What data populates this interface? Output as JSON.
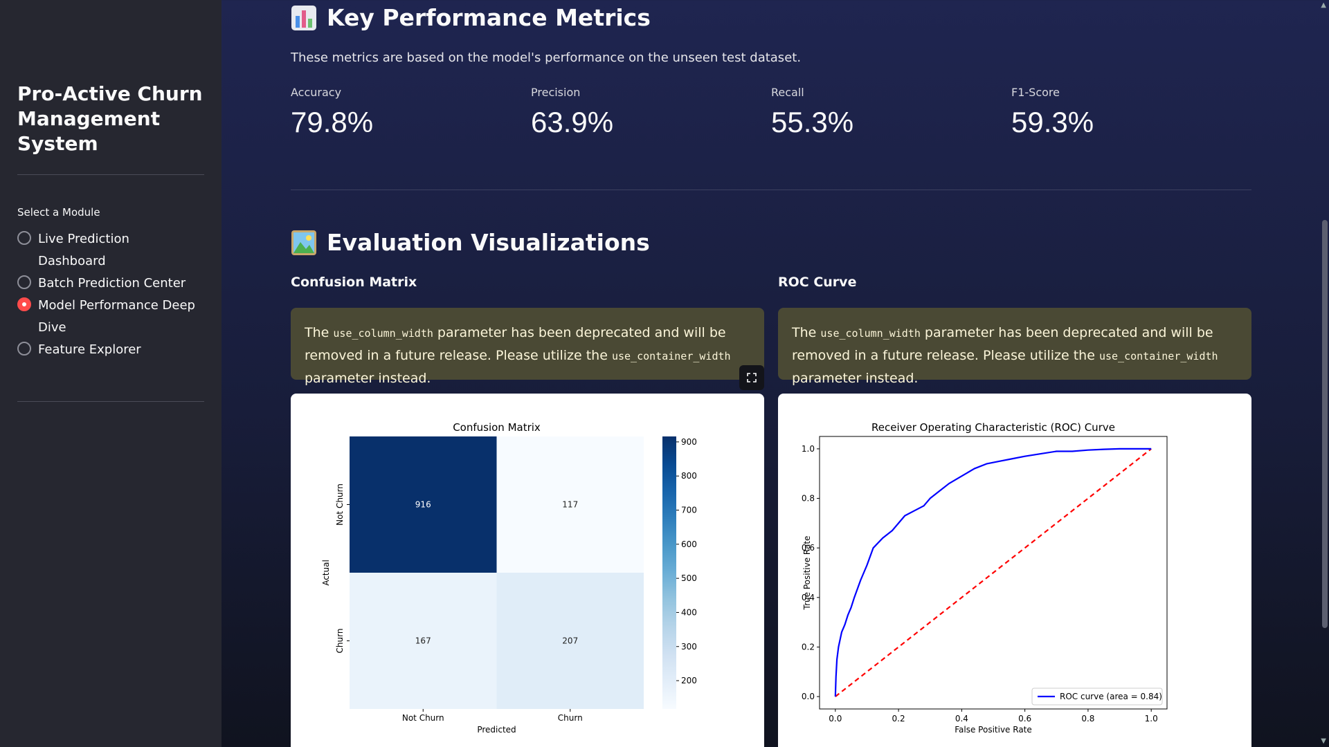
{
  "sidebar": {
    "app_title": "Pro-Active Churn Management System",
    "module_label": "Select a Module",
    "modules": [
      {
        "label": "Live Prediction Dashboard",
        "selected": false
      },
      {
        "label": "Batch Prediction Center",
        "selected": false
      },
      {
        "label": "Model Performance Deep Dive",
        "selected": true
      },
      {
        "label": "Feature Explorer",
        "selected": false
      }
    ]
  },
  "metrics_section": {
    "title": "Key Performance Metrics",
    "icon": "bar-chart-icon",
    "caption": "These metrics are based on the model's performance on the unseen test dataset.",
    "metrics": [
      {
        "label": "Accuracy",
        "value": "79.8%"
      },
      {
        "label": "Precision",
        "value": "63.9%"
      },
      {
        "label": "Recall",
        "value": "55.3%"
      },
      {
        "label": "F1-Score",
        "value": "59.3%"
      }
    ]
  },
  "viz_section": {
    "title": "Evaluation Visualizations",
    "icon": "picture-icon",
    "confusion_heading": "Confusion Matrix",
    "roc_heading": "ROC Curve",
    "warning": {
      "part1": "The ",
      "code1": "use_column_width",
      "part2": " parameter has been deprecated and will be removed in a future release. Please utilize the ",
      "code2": "use_container_width",
      "part3": " parameter instead."
    }
  },
  "colors": {
    "accent": "#ff4b4b",
    "sidebar_bg": "#262730",
    "warning_bg": "#4a4934",
    "heatmap_dark": "#08306b",
    "roc_line": "#0000ff",
    "diag_line": "#ff0000"
  },
  "chart_data": [
    {
      "type": "heatmap",
      "title": "Confusion Matrix",
      "xlabel": "Predicted",
      "ylabel": "Actual",
      "x_categories": [
        "Not Churn",
        "Churn"
      ],
      "y_categories": [
        "Not Churn",
        "Churn"
      ],
      "values": [
        [
          916,
          117
        ],
        [
          167,
          207
        ]
      ],
      "colorbar_ticks": [
        900,
        800,
        700,
        600,
        500,
        400,
        300,
        200
      ],
      "colorbar_range": [
        117,
        916
      ],
      "colormap": "Blues"
    },
    {
      "type": "line",
      "title": "Receiver Operating Characteristic (ROC) Curve",
      "xlabel": "False Positive Rate",
      "ylabel": "True Positive Rate",
      "xlim": [
        0,
        1
      ],
      "ylim": [
        0,
        1
      ],
      "x_ticks": [
        "0.0",
        "0.2",
        "0.4",
        "0.6",
        "0.8",
        "1.0"
      ],
      "y_ticks": [
        "0.0",
        "0.2",
        "0.4",
        "0.6",
        "0.8",
        "1.0"
      ],
      "legend": "lower right",
      "series": [
        {
          "name": "ROC curve (area = 0.84)",
          "color": "#0000ff",
          "x": [
            0,
            0.002,
            0.005,
            0.01,
            0.02,
            0.03,
            0.04,
            0.05,
            0.06,
            0.08,
            0.1,
            0.12,
            0.15,
            0.18,
            0.2,
            0.22,
            0.25,
            0.28,
            0.3,
            0.33,
            0.36,
            0.4,
            0.44,
            0.48,
            0.52,
            0.56,
            0.6,
            0.65,
            0.7,
            0.75,
            0.8,
            0.85,
            0.9,
            0.95,
            1.0
          ],
          "y": [
            0,
            0.08,
            0.15,
            0.2,
            0.26,
            0.29,
            0.33,
            0.36,
            0.4,
            0.47,
            0.53,
            0.6,
            0.64,
            0.67,
            0.7,
            0.73,
            0.75,
            0.77,
            0.8,
            0.83,
            0.86,
            0.89,
            0.92,
            0.94,
            0.95,
            0.96,
            0.97,
            0.98,
            0.99,
            0.99,
            0.995,
            0.998,
            1.0,
            1.0,
            1.0
          ]
        },
        {
          "name": "",
          "color": "#ff0000",
          "style": "dashed",
          "x": [
            0,
            1
          ],
          "y": [
            0,
            1
          ]
        }
      ]
    }
  ]
}
